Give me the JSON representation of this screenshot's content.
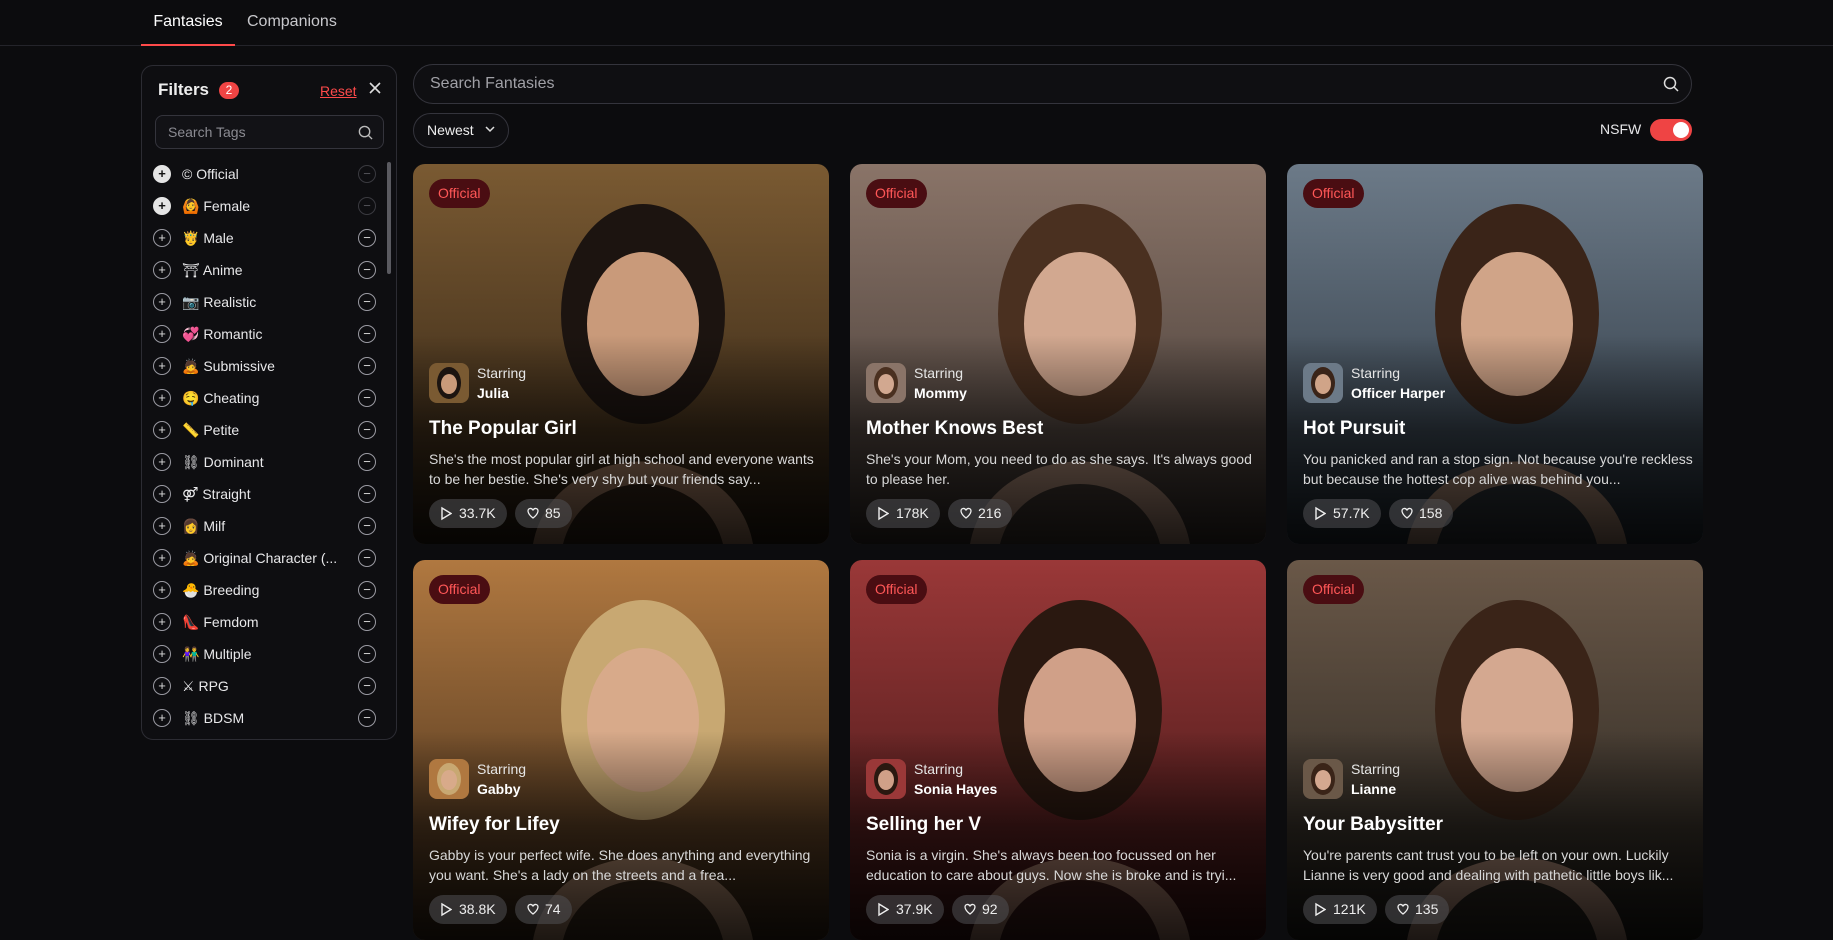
{
  "nav": {
    "tabs": [
      {
        "label": "Fantasies",
        "active": true
      },
      {
        "label": "Companions",
        "active": false
      }
    ]
  },
  "filters": {
    "title": "Filters",
    "count": "2",
    "reset_label": "Reset",
    "close_icon": "close-icon",
    "tag_search_placeholder": "Search Tags",
    "tags": [
      {
        "emoji": "©",
        "label": "Official",
        "selected": true
      },
      {
        "emoji": "🙆",
        "label": "Female",
        "selected": true
      },
      {
        "emoji": "🤴",
        "label": "Male"
      },
      {
        "emoji": "⛩",
        "label": "Anime"
      },
      {
        "emoji": "📷",
        "label": "Realistic"
      },
      {
        "emoji": "💞",
        "label": "Romantic"
      },
      {
        "emoji": "🙇",
        "label": "Submissive"
      },
      {
        "emoji": "🤤",
        "label": "Cheating"
      },
      {
        "emoji": "📏",
        "label": "Petite"
      },
      {
        "emoji": "⛓",
        "label": "Dominant"
      },
      {
        "emoji": "⚤",
        "label": "Straight"
      },
      {
        "emoji": "👩",
        "label": "Milf"
      },
      {
        "emoji": "🙇",
        "label": "Original Character (..."
      },
      {
        "emoji": "🐣",
        "label": "Breeding"
      },
      {
        "emoji": "👠",
        "label": "Femdom"
      },
      {
        "emoji": "👫",
        "label": "Multiple"
      },
      {
        "emoji": "⚔",
        "label": "RPG"
      },
      {
        "emoji": "⛓",
        "label": "BDSM"
      }
    ]
  },
  "search": {
    "placeholder": "Search Fantasies"
  },
  "sort": {
    "value": "Newest"
  },
  "nsfw": {
    "label": "NSFW",
    "enabled": true
  },
  "cards": [
    {
      "badge": "Official",
      "starring_label": "Starring",
      "star": "Julia",
      "title": "The Popular Girl",
      "desc": "She's the most popular girl at high school and everyone wants to be her bestie. She's very shy but your friends say...",
      "plays": "33.7K",
      "likes": "85",
      "bg": "#7a5a32",
      "bg2": "#2a1e12",
      "skin": "#c99a7a",
      "hair": "#1c1410"
    },
    {
      "badge": "Official",
      "starring_label": "Starring",
      "star": "Mommy",
      "title": "Mother Knows Best",
      "desc": "She's your Mom, you need to do as she says. It's always good to please her.",
      "plays": "178K",
      "likes": "216",
      "bg": "#8a7468",
      "bg2": "#3c3430",
      "skin": "#d2a890",
      "hair": "#4a3020"
    },
    {
      "badge": "Official",
      "starring_label": "Starring",
      "star": "Officer Harper",
      "title": "Hot Pursuit",
      "desc": "You panicked and ran a stop sign. Not because you're reckless but because the hottest cop alive was behind you...",
      "plays": "57.7K",
      "likes": "158",
      "bg": "#6c7a88",
      "bg2": "#26303a",
      "skin": "#d0a488",
      "hair": "#3a2418"
    },
    {
      "badge": "Official",
      "starring_label": "Starring",
      "star": "Gabby",
      "title": "Wifey for Lifey",
      "desc": "Gabby is your perfect wife. She does anything and everything you want. She's a lady on the streets and a frea...",
      "plays": "38.8K",
      "likes": "74",
      "bg": "#b07840",
      "bg2": "#3a2818",
      "skin": "#d8aa8a",
      "hair": "#c8a872"
    },
    {
      "badge": "Official",
      "starring_label": "Starring",
      "star": "Sonia Hayes",
      "title": "Selling her V",
      "desc": "Sonia is a virgin. She's always been too focussed on her education to care about guys. Now she is broke and is tryi...",
      "plays": "37.9K",
      "likes": "92",
      "bg": "#9a3838",
      "bg2": "#3a1414",
      "skin": "#d0a088",
      "hair": "#2a1810"
    },
    {
      "badge": "Official",
      "starring_label": "Starring",
      "star": "Lianne",
      "title": "Your Babysitter",
      "desc": "You're parents cant trust you to be left on your own. Luckily Lianne is very good and dealing with pathetic little boys lik...",
      "plays": "121K",
      "likes": "135",
      "bg": "#6a5848",
      "bg2": "#22201c",
      "skin": "#d4a890",
      "hair": "#3a2418"
    }
  ]
}
